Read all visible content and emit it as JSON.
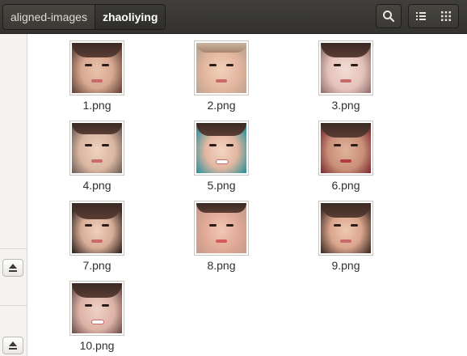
{
  "path_bar": {
    "parent": "aligned-images",
    "current": "zhaoliying"
  },
  "toolbar": {
    "search_icon": "search-icon",
    "list_view_icon": "list-view-icon",
    "grid_view_icon": "grid-view-icon"
  },
  "sidebar": {
    "eject_icon": "eject-icon"
  },
  "files": [
    {
      "name": "1.png"
    },
    {
      "name": "2.png"
    },
    {
      "name": "3.png"
    },
    {
      "name": "4.png"
    },
    {
      "name": "5.png"
    },
    {
      "name": "6.png"
    },
    {
      "name": "7.png"
    },
    {
      "name": "8.png"
    },
    {
      "name": "9.png"
    },
    {
      "name": "10.png"
    }
  ]
}
